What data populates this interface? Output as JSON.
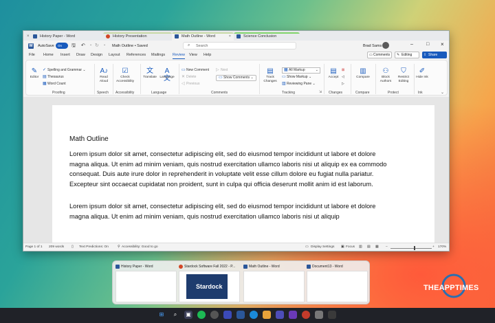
{
  "tabs": [
    {
      "label": "History Paper - Word",
      "color": "#2b579a"
    },
    {
      "label": "History Presentation",
      "color": "#d24726"
    },
    {
      "label": "Math Outline - Word",
      "color": "#2b579a"
    },
    {
      "label": "Science Conclusion",
      "color": "#2b579a"
    }
  ],
  "titlebar": {
    "autosave_label": "AutoSave",
    "autosave_state": "On",
    "doc_title": "Math Outline • Saved",
    "search_placeholder": "Search",
    "user_name": "Brad Sams"
  },
  "ribbon_tabs": [
    "File",
    "Home",
    "Insert",
    "Draw",
    "Design",
    "Layout",
    "References",
    "Mailings",
    "Review",
    "View",
    "Help"
  ],
  "ribbon_right": {
    "comments": "Comments",
    "editing": "Editing",
    "share": "Share"
  },
  "ribbon": {
    "editor": "Editor",
    "spelling": "Spelling and Grammar",
    "thesaurus": "Thesaurus",
    "word_count": "Word Count",
    "proofing": "Proofing",
    "read_aloud": "Read Aloud",
    "speech": "Speech",
    "check_accessibility": "Check Accessibility",
    "accessibility": "Accessibility",
    "translate": "Translate",
    "language_btn": "Language",
    "language": "Language",
    "new_comment": "New Comment",
    "delete": "Delete",
    "previous": "Previous",
    "next": "Next",
    "show_comments": "Show Comments",
    "comments": "Comments",
    "track_changes": "Track Changes",
    "all_markup": "All Markup",
    "show_markup": "Show Markup",
    "reviewing_pane": "Reviewing Pane",
    "tracking": "Tracking",
    "accept": "Accept",
    "changes": "Changes",
    "compare_btn": "Compare",
    "compare": "Compare",
    "block_authors": "Block Authors",
    "restrict_editing": "Restrict Editing",
    "protect": "Protect",
    "hide_ink": "Hide Ink",
    "ink": "Ink"
  },
  "document": {
    "heading": "Math Outline",
    "para1": "Lorem ipsum dolor sit amet, consectetur adipiscing elit, sed do eiusmod tempor incididunt ut labore et dolore magna aliqua. Ut enim ad minim veniam, quis nostrud exercitation ullamco laboris nisi ut aliquip ex ea commodo consequat. Duis aute irure dolor in reprehenderit in voluptate velit esse cillum dolore eu fugiat nulla pariatur. Excepteur sint occaecat cupidatat non proident, sunt in culpa qui officia deserunt mollit anim id est laborum.",
    "para2": "Lorem ipsum dolor sit amet, consectetur adipiscing elit, sed do eiusmod tempor incididunt ut labore et dolore magna aliqua. Ut enim ad minim veniam, quis nostrud exercitation ullamco laboris nisi ut aliquip"
  },
  "status": {
    "page": "Page 1 of 1",
    "words": "209 words",
    "text_predictions": "Text Predictions: On",
    "accessibility": "Accessibility: Good to go",
    "display_settings": "Display Settings",
    "focus": "Focus",
    "zoom": "170%"
  },
  "thumbnails": [
    {
      "label": "History Paper - Word",
      "color": "#2b579a"
    },
    {
      "label": "Stardock Software Fall 2022 - P...",
      "color": "#d24726"
    },
    {
      "label": "Math Outline - Word",
      "color": "#2b579a"
    },
    {
      "label": "Document13 - Word",
      "color": "#2b579a"
    }
  ],
  "stardock_text": "Stardock",
  "watermark": "THEAPPTIMES"
}
